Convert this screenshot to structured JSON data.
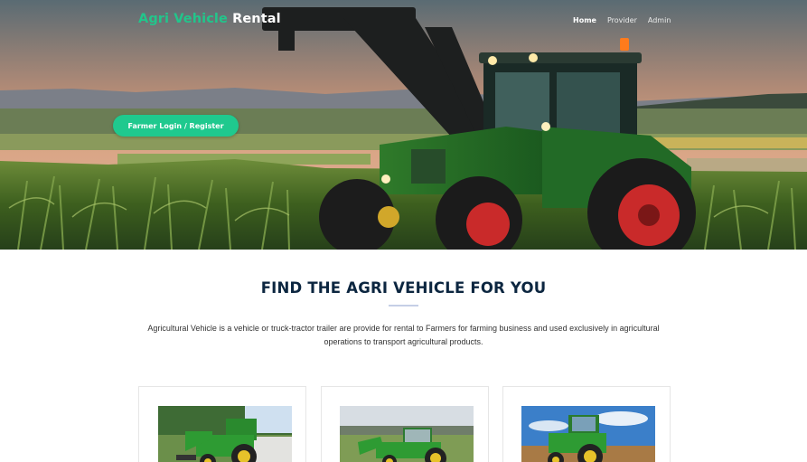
{
  "header": {
    "brand_part1": "Agri Vehicle",
    "brand_part2": "Rental",
    "brand_accent_color": "#22c58b",
    "nav": [
      {
        "label": "Home",
        "active": true
      },
      {
        "label": "Provider",
        "active": false
      },
      {
        "label": "Admin",
        "active": false
      }
    ]
  },
  "hero": {
    "cta_label": "Farmer Login / Register",
    "cta_color": "#1fc98e",
    "image": "tractor-in-cornfield"
  },
  "section": {
    "title": "FIND THE AGRI VEHICLE FOR YOU",
    "description": "Agricultural Vehicle is a vehicle or truck-tractor trailer are provide for rental to Farmers for farming business and used exclusively in agricultural operations to transport agricultural products."
  },
  "cards": [
    {
      "image": "green-tractor-front-loader-trees"
    },
    {
      "image": "green-tractor-front-loader-field"
    },
    {
      "image": "green-tractor-blue-sky"
    }
  ]
}
